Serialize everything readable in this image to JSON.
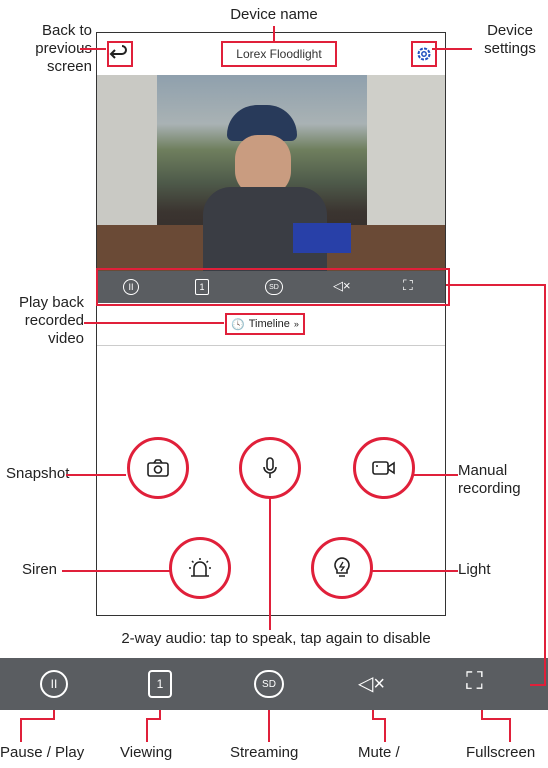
{
  "annotations": {
    "back": "Back to previous screen",
    "device_name": "Device name",
    "settings": "Device settings",
    "playback": "Play back recorded video",
    "snapshot": "Snapshot",
    "manual_recording": "Manual recording",
    "siren": "Siren",
    "light": "Light",
    "two_way_audio": "2-way audio: tap to speak, tap again to disable",
    "pause_play": "Pause / Play",
    "viewing": "Viewing",
    "streaming": "Streaming",
    "mute": "Mute /",
    "fullscreen": "Fullscreen"
  },
  "app": {
    "device_name": "Lorex Floodlight",
    "timeline_label": "Timeline"
  },
  "controls": {
    "channel": "1",
    "quality": "SD"
  },
  "icons": [
    "back-arrow-icon",
    "gear-icon",
    "pause-icon",
    "channel-icon",
    "sd-icon",
    "mute-icon",
    "fullscreen-icon",
    "clock-icon",
    "chevron-down-icon",
    "camera-icon",
    "microphone-icon",
    "video-record-icon",
    "siren-icon",
    "light-bulb-icon"
  ],
  "colors": {
    "accent": "#e0203a",
    "control_bar": "#5a5d61"
  }
}
